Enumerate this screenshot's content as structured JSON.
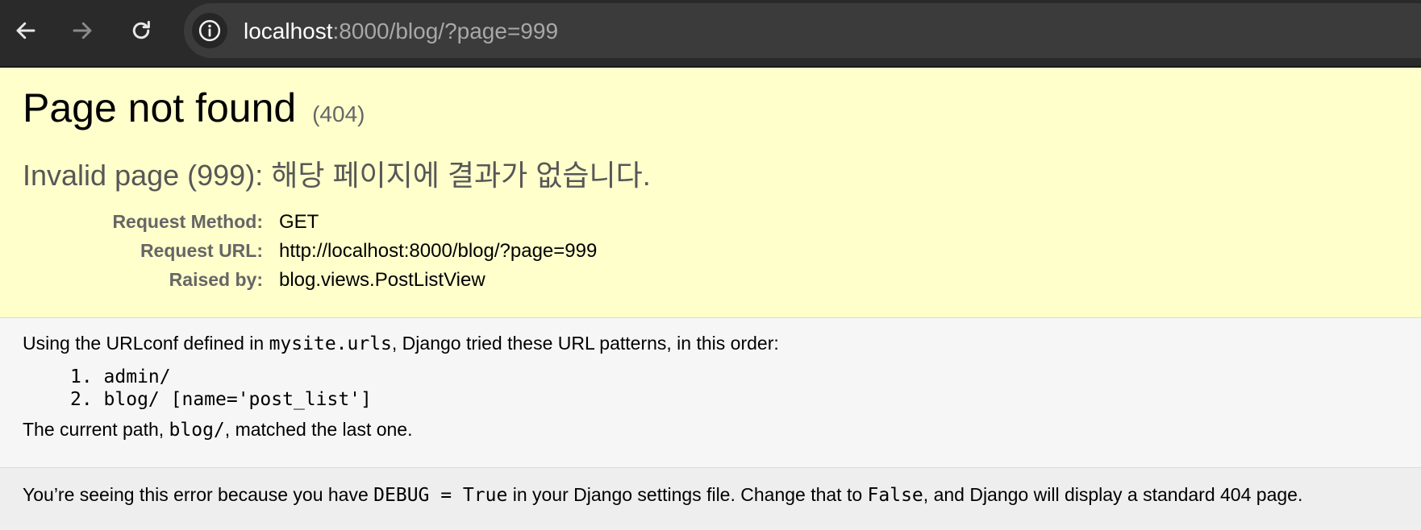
{
  "browser": {
    "back_icon": "arrow-left-icon",
    "forward_icon": "arrow-right-icon",
    "reload_icon": "reload-icon",
    "info_icon": "info-circle-icon",
    "url_host": "localhost",
    "url_rest": ":8000/blog/?page=999"
  },
  "error": {
    "title": "Page not found",
    "code": "(404)",
    "exception_message": "Invalid page (999): 해당 페이지에 결과가 없습니다.",
    "request": [
      {
        "label": "Request Method:",
        "value": "GET"
      },
      {
        "label": "Request URL:",
        "value": "http://localhost:8000/blog/?page=999"
      },
      {
        "label": "Raised by:",
        "value": "blog.views.PostListView"
      }
    ]
  },
  "urlconf": {
    "intro_before": "Using the URLconf defined in ",
    "module": "mysite.urls",
    "intro_after": ", Django tried these URL patterns, in this order:",
    "patterns": [
      "1. admin/",
      "2. blog/ [name='post_list']"
    ],
    "current_before": "The current path, ",
    "current_path": "blog/",
    "current_after": ", matched the last one."
  },
  "debug_note": {
    "part1": "You’re seeing this error because you have ",
    "code1": "DEBUG = True",
    "part2": " in your Django settings file. Change that to ",
    "code2": "False",
    "part3": ", and Django will display a standard 404 page."
  },
  "colors": {
    "summary_bg": "#ffffcc",
    "toolbar_bg": "#2a2a2a",
    "omnibox_bg": "#3b3b3b"
  }
}
